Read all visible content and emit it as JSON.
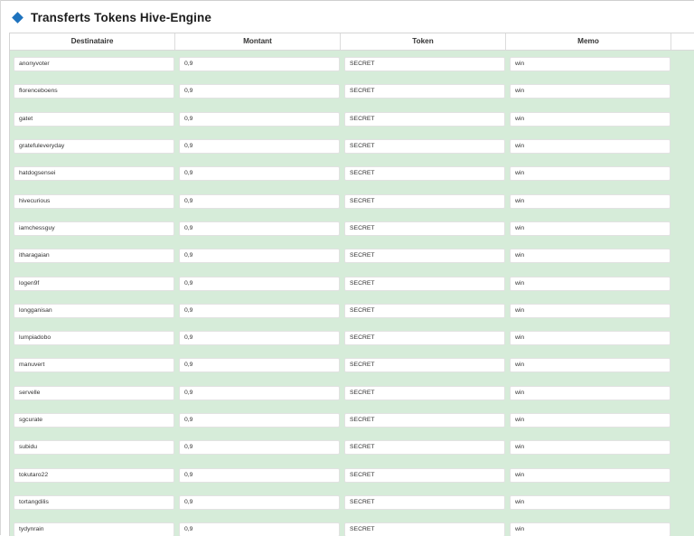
{
  "title": "Transferts Tokens Hive-Engine",
  "accent_color": "#1e73be",
  "row_background": "#d6ecd9",
  "icons": {
    "title": "diamond-icon"
  },
  "columns": [
    "Destinataire",
    "Montant",
    "Token",
    "Memo"
  ],
  "rows": [
    {
      "destinataire": "anonyvoter",
      "montant": "0,9",
      "token": "SECRET",
      "memo": "win"
    },
    {
      "destinataire": "florenceboens",
      "montant": "0,9",
      "token": "SECRET",
      "memo": "win"
    },
    {
      "destinataire": "gatet",
      "montant": "0,9",
      "token": "SECRET",
      "memo": "win"
    },
    {
      "destinataire": "gratefuleveryday",
      "montant": "0,9",
      "token": "SECRET",
      "memo": "win"
    },
    {
      "destinataire": "hatdogsensei",
      "montant": "0,9",
      "token": "SECRET",
      "memo": "win"
    },
    {
      "destinataire": "hivecurious",
      "montant": "0,9",
      "token": "SECRET",
      "memo": "win"
    },
    {
      "destinataire": "iamchessguy",
      "montant": "0,9",
      "token": "SECRET",
      "memo": "win"
    },
    {
      "destinataire": "itharagaian",
      "montant": "0,9",
      "token": "SECRET",
      "memo": "win"
    },
    {
      "destinataire": "logen9f",
      "montant": "0,9",
      "token": "SECRET",
      "memo": "win"
    },
    {
      "destinataire": "longganisan",
      "montant": "0,9",
      "token": "SECRET",
      "memo": "win"
    },
    {
      "destinataire": "lumpiadobo",
      "montant": "0,9",
      "token": "SECRET",
      "memo": "win"
    },
    {
      "destinataire": "manuvert",
      "montant": "0,9",
      "token": "SECRET",
      "memo": "win"
    },
    {
      "destinataire": "servelle",
      "montant": "0,9",
      "token": "SECRET",
      "memo": "win"
    },
    {
      "destinataire": "sgcurate",
      "montant": "0,9",
      "token": "SECRET",
      "memo": "win"
    },
    {
      "destinataire": "subidu",
      "montant": "0,9",
      "token": "SECRET",
      "memo": "win"
    },
    {
      "destinataire": "tokutaro22",
      "montant": "0,9",
      "token": "SECRET",
      "memo": "win"
    },
    {
      "destinataire": "tortangdilis",
      "montant": "0,9",
      "token": "SECRET",
      "memo": "win"
    },
    {
      "destinataire": "tydynrain",
      "montant": "0,9",
      "token": "SECRET",
      "memo": "win"
    }
  ]
}
